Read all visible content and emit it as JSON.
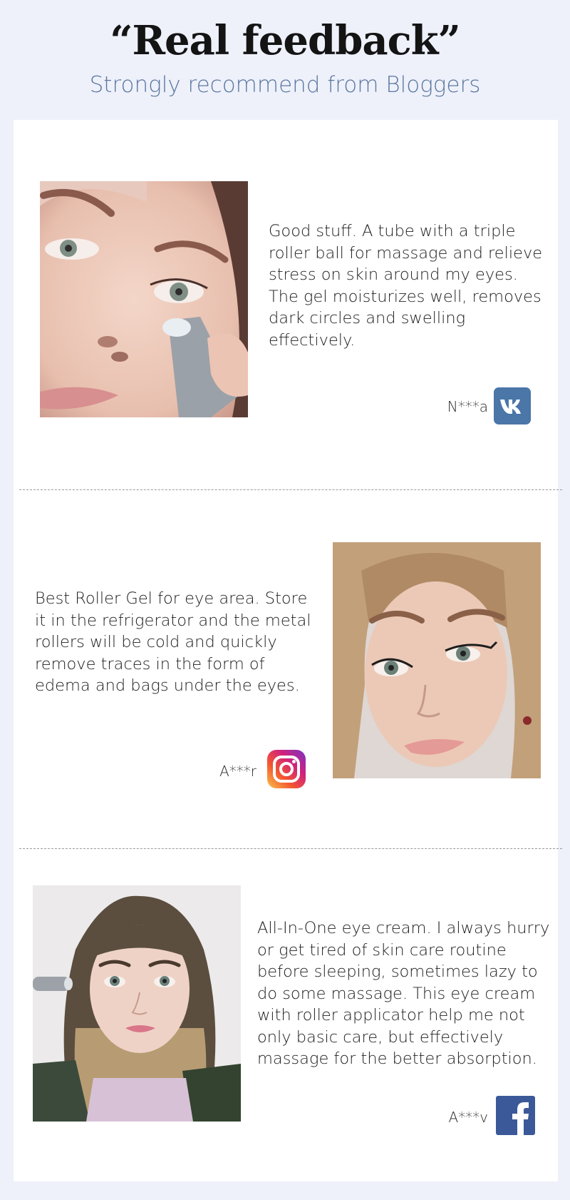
{
  "header": {
    "title": "“Real feedback”",
    "subtitle": "Strongly recommend from Bloggers"
  },
  "reviews": [
    {
      "text": "Good stuff. A tube with a triple roller ball for massage and relieve stress on skin around my eyes. The gel moisturizes well, removes dark circles and swelling effectively.",
      "author": "N***a",
      "social_icon": "vk-icon",
      "social_color": "#4a76a8"
    },
    {
      "text": "Best Roller Gel for eye area. Store it in the refrigerator and the metal rollers will be cold and quickly remove traces in the form of edema and bags under the eyes.",
      "author": "A***r",
      "social_icon": "instagram-icon",
      "social_color": "#d6249f"
    },
    {
      "text": "All-In-One eye cream. I always hurry or get tired of skin care routine before sleeping, sometimes lazy to do some massage. This eye cream with roller applicator help me not only basic care, but effectively massage for the better absorption.",
      "author": "A***v",
      "social_icon": "facebook-icon",
      "social_color": "#3b5998"
    }
  ]
}
